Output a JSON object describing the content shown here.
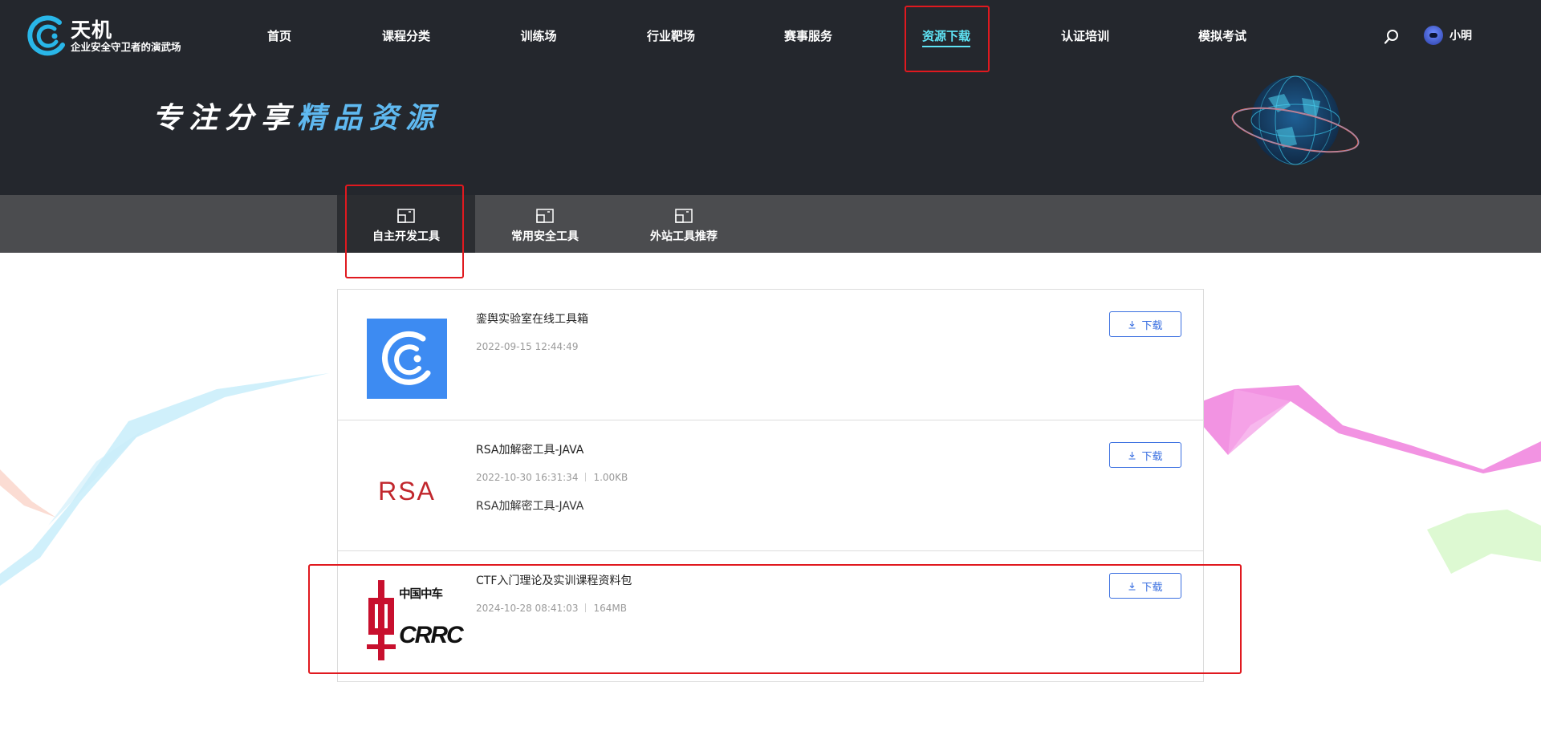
{
  "header": {
    "logo_name": "天机",
    "logo_slogan": "企业安全守卫者的演武场",
    "nav": [
      {
        "label": "首页",
        "active": false
      },
      {
        "label": "课程分类",
        "active": false
      },
      {
        "label": "训练场",
        "active": false
      },
      {
        "label": "行业靶场",
        "active": false
      },
      {
        "label": "赛事服务",
        "active": false
      },
      {
        "label": "资源下载",
        "active": true
      },
      {
        "label": "认证培训",
        "active": false
      },
      {
        "label": "模拟考试",
        "active": false
      }
    ],
    "user_name": "小明"
  },
  "hero": {
    "title_white": "专注分享",
    "title_accent": "精品资源"
  },
  "tabs": [
    {
      "label": "自主开发工具",
      "active": true
    },
    {
      "label": "常用安全工具",
      "active": false
    },
    {
      "label": "外站工具推荐",
      "active": false
    }
  ],
  "resources": [
    {
      "title": "銮舆实验室在线工具箱",
      "date": "2022-09-15 12:44:49",
      "size": "",
      "description": "",
      "download_label": "下载",
      "thumb": "tianji-logo-icon"
    },
    {
      "title": "RSA加解密工具-JAVA",
      "date": "2022-10-30 16:31:34",
      "size": "1.00KB",
      "description": "RSA加解密工具-JAVA",
      "download_label": "下载",
      "thumb_text": "RSA"
    },
    {
      "title": "CTF入门理论及实训课程资料包",
      "date": "2024-10-28 08:41:03",
      "size": "164MB",
      "description": "",
      "download_label": "下载",
      "thumb_text_cn": "中国中车",
      "thumb_text_en": "CRRC"
    }
  ],
  "colors": {
    "header_bg": "#24272d",
    "tabbar_bg": "#4b4c4f",
    "active_nav": "#5fe3f4",
    "download_blue": "#3a6fe0",
    "highlight_red": "#e0191f"
  }
}
